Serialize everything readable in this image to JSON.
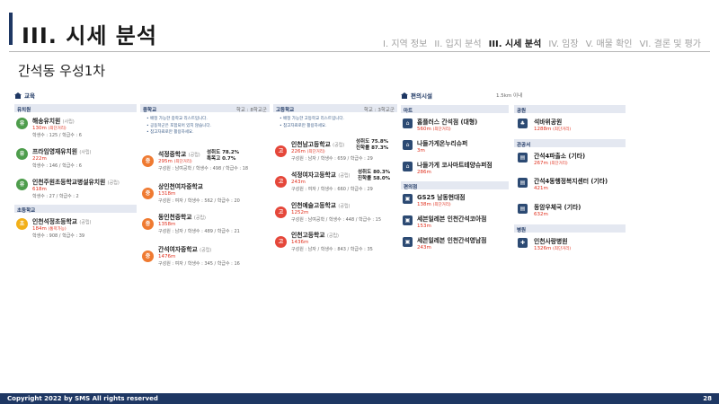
{
  "header": {
    "title": "III. 시세 분석",
    "nav": [
      "I. 지역 정보",
      "II. 입지 분석",
      "III. 시세 분석",
      "IV. 임장",
      "V. 매물 확인",
      "VI. 결론 및 평가"
    ],
    "active_nav_index": 2
  },
  "subtitle": "간석동 우성1차",
  "education": {
    "heading": "교육",
    "kindergarten": {
      "label": "유치원",
      "items": [
        {
          "icon": "유",
          "name": "해송유치원",
          "type": "(사립)",
          "dist": "130m",
          "dist_note": "(최단거리)",
          "info": "학생수 : 125 / 학급수 : 6"
        },
        {
          "icon": "유",
          "name": "프라임영재유치원",
          "type": "(사립)",
          "dist": "222m",
          "dist_note": "",
          "info": "학생수 : 146 / 학급수 : 6"
        },
        {
          "icon": "유",
          "name": "인천주원초등학교병설유치원",
          "type": "(공립)",
          "dist": "618m",
          "dist_note": "",
          "info": "학생수 : 27 / 학급수 : 2"
        }
      ]
    },
    "elementary": {
      "label": "초등학교",
      "items": [
        {
          "icon": "초",
          "name": "인천석정초등학교",
          "type": "(공립)",
          "dist": "184m",
          "dist_note": "(통학가능)",
          "info": "학생수 : 908 / 학급수 : 39"
        }
      ]
    },
    "middle": {
      "label": "중학교",
      "right": "학교 : 8학교군",
      "notes": [
        "배정 가능한 중학교 리스트입니다.",
        "공동학군은 포함되어 있지 않습니다.",
        "참고자료로만 활용하세요."
      ],
      "items": [
        {
          "icon": "중",
          "name": "석정중학교",
          "type": "(공립)",
          "dist": "295m",
          "dist_note": "(최단거리)",
          "info": "구성원 : 남여공학 / 학생수 : 498 / 학급수 : 18",
          "rate1": "성취도 78.2%",
          "rate2": "특목고 0.7%"
        },
        {
          "icon": "중",
          "name": "상인천여자중학교",
          "type": "",
          "dist": "1318m",
          "dist_note": "",
          "info": "구성원 : 여자 / 학생수 : 562 / 학급수 : 20",
          "rate1": "",
          "rate2": ""
        },
        {
          "icon": "중",
          "name": "동인천중학교",
          "type": "(공립)",
          "dist": "1358m",
          "dist_note": "",
          "info": "구성원 : 남자 / 학생수 : 489 / 학급수 : 21",
          "rate1": "",
          "rate2": ""
        },
        {
          "icon": "중",
          "name": "간석여자중학교",
          "type": "(공립)",
          "dist": "1476m",
          "dist_note": "",
          "info": "구성원 : 여자 / 학생수 : 345 / 학급수 : 16",
          "rate1": "",
          "rate2": ""
        }
      ]
    },
    "high": {
      "label": "고등학교",
      "right": "학교 : 3학교군",
      "notes": [
        "배정 가능한 고등학교 리스트입니다.",
        "참고자료로만 활용하세요."
      ],
      "items": [
        {
          "icon": "고",
          "name": "인천남고등학교",
          "type": "(공립)",
          "dist": "226m",
          "dist_note": "(최단거리)",
          "info": "구성원 : 남자 / 학생수 : 659 / 학급수 : 29",
          "rate1": "성취도 75.8%",
          "rate2": "진학률 87.3%"
        },
        {
          "icon": "고",
          "name": "석정여자고등학교",
          "type": "(공립)",
          "dist": "243m",
          "dist_note": "",
          "info": "구성원 : 여자 / 학생수 : 660 / 학급수 : 29",
          "rate1": "성취도 80.3%",
          "rate2": "진학률 58.0%"
        },
        {
          "icon": "고",
          "name": "인천예술고등학교",
          "type": "(공립)",
          "dist": "1252m",
          "dist_note": "",
          "info": "구성원 : 남여공학 / 학생수 : 448 / 학급수 : 15",
          "rate1": "",
          "rate2": ""
        },
        {
          "icon": "고",
          "name": "인천고등학교",
          "type": "(공립)",
          "dist": "1436m",
          "dist_note": "",
          "info": "구성원 : 남자 / 학생수 : 843 / 학급수 : 35",
          "rate1": "",
          "rate2": ""
        }
      ]
    }
  },
  "facilities": {
    "heading": "편의시설",
    "range": "1.5km 이내",
    "mart": {
      "label": "마트",
      "items": [
        {
          "name": "홈플러스 간석점 (대형)",
          "dist": "560m",
          "dist_note": "(최단거리)"
        },
        {
          "name": "나들가게온누리슈퍼",
          "dist": "3m",
          "dist_note": ""
        },
        {
          "name": "나들가게 코사마트테양슈퍼점",
          "dist": "286m",
          "dist_note": ""
        }
      ]
    },
    "convenience": {
      "label": "편의점",
      "items": [
        {
          "name": "GS25 남동현대점",
          "dist": "138m",
          "dist_note": "(최단거리)"
        },
        {
          "name": "세븐일레븐 인천간석코아점",
          "dist": "153m",
          "dist_note": ""
        },
        {
          "name": "세븐일레븐 인천간석영남점",
          "dist": "243m",
          "dist_note": ""
        }
      ]
    },
    "park": {
      "label": "공원",
      "items": [
        {
          "name": "석바위공원",
          "dist": "1288m",
          "dist_note": "(최단거리)"
        }
      ]
    },
    "office": {
      "label": "관공서",
      "items": [
        {
          "name": "간석4파출소 (기타)",
          "dist": "267m",
          "dist_note": "(최단거리)"
        },
        {
          "name": "간석4동행정복지센터 (기타)",
          "dist": "421m",
          "dist_note": ""
        },
        {
          "name": "동암우체국 (기타)",
          "dist": "632m",
          "dist_note": ""
        }
      ]
    },
    "hospital": {
      "label": "병원",
      "items": [
        {
          "name": "인천사랑병원",
          "dist": "1326m",
          "dist_note": "(최단거리)"
        }
      ]
    }
  },
  "footer": {
    "copyright": "Copyright 2022 by SMS All rights reserved",
    "page": "28"
  }
}
